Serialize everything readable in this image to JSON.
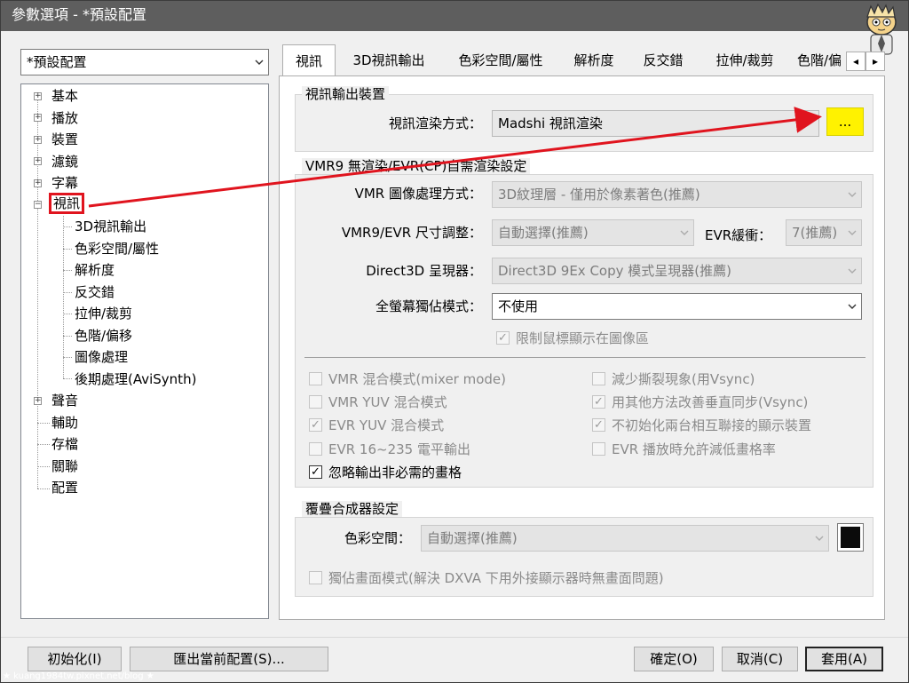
{
  "window": {
    "title": "參數選項 - *預設配置"
  },
  "profile_combo": {
    "value": "*預設配置"
  },
  "tree": {
    "items": [
      {
        "label": "基本"
      },
      {
        "label": "播放"
      },
      {
        "label": "裝置"
      },
      {
        "label": "濾鏡"
      },
      {
        "label": "字幕"
      },
      {
        "label": "視訊"
      },
      {
        "label": "3D視訊輸出"
      },
      {
        "label": "色彩空間/屬性"
      },
      {
        "label": "解析度"
      },
      {
        "label": "反交錯"
      },
      {
        "label": "拉伸/裁剪"
      },
      {
        "label": "色階/偏移"
      },
      {
        "label": "圖像處理"
      },
      {
        "label": "後期處理(AviSynth)"
      },
      {
        "label": "聲音"
      },
      {
        "label": "輔助"
      },
      {
        "label": "存檔"
      },
      {
        "label": "關聯"
      },
      {
        "label": "配置"
      }
    ]
  },
  "tabs": {
    "items": [
      {
        "label": "視訊"
      },
      {
        "label": "3D視訊輸出"
      },
      {
        "label": "色彩空間/屬性"
      },
      {
        "label": "解析度"
      },
      {
        "label": "反交錯"
      },
      {
        "label": "拉伸/裁剪"
      },
      {
        "label": "色階/偏"
      }
    ],
    "scroll_left": "◂",
    "scroll_right": "▸"
  },
  "output_device": {
    "group_title": "視訊輸出裝置",
    "renderer_label": "視訊渲染方式：",
    "renderer_value": "Madshi 視訊渲染",
    "browse_label": "..."
  },
  "vmr_group": {
    "title": "VMR9 無渲染/EVR(CP)自需渲染設定",
    "image_proc_label": "VMR 圖像處理方式：",
    "image_proc_value": "3D紋理層 - 僅用於像素著色(推薦)",
    "resize_label": "VMR9/EVR 尺寸調整：",
    "resize_value": "自動選擇(推薦)",
    "evr_buffer_label": "EVR緩衝：",
    "evr_buffer_value": "7(推薦)",
    "d3d_label": "Direct3D 呈現器：",
    "d3d_value": "Direct3D 9Ex Copy 模式呈現器(推薦)",
    "fullscreen_label": "全螢幕獨佔模式：",
    "fullscreen_value": "不使用",
    "limit_mouse_label": "限制鼠標顯示在圖像區",
    "checkboxes_left": [
      {
        "label": "VMR 混合模式(mixer mode)",
        "checked": false,
        "enabled": false
      },
      {
        "label": "VMR YUV 混合模式",
        "checked": false,
        "enabled": false
      },
      {
        "label": "EVR YUV 混合模式",
        "checked": true,
        "enabled": false
      },
      {
        "label": "EVR 16~235 電平輸出",
        "checked": false,
        "enabled": false
      },
      {
        "label": "忽略輸出非必需的畫格",
        "checked": true,
        "enabled": true
      }
    ],
    "checkboxes_right": [
      {
        "label": "減少撕裂現象(用Vsync)",
        "checked": false,
        "enabled": false
      },
      {
        "label": "用其他方法改善垂直同步(Vsync)",
        "checked": true,
        "enabled": false
      },
      {
        "label": "不初始化兩台相互聯接的顯示裝置",
        "checked": true,
        "enabled": false
      },
      {
        "label": "EVR 播放時允許減低畫格率",
        "checked": false,
        "enabled": false
      }
    ]
  },
  "overlay_group": {
    "title": "覆疊合成器設定",
    "color_space_label": "色彩空間：",
    "color_space_value": "自動選擇(推薦)",
    "swatch_color": "#0b0b0b",
    "exclusive_label": "獨佔畫面模式(解決 DXVA 下用外接顯示器時無畫面問題)"
  },
  "buttons": {
    "reset": "初始化(I)",
    "export": "匯出當前配置(S)...",
    "ok": "確定(O)",
    "cancel": "取消(C)",
    "apply": "套用(A)"
  },
  "colors": {
    "highlight_yellow": "#fff200",
    "annotation_red": "#e0141e",
    "titlebar": "#5e5e5e"
  },
  "watermark": {
    "text": "★ kuang1984tw.pixnet.net/blog ★"
  }
}
